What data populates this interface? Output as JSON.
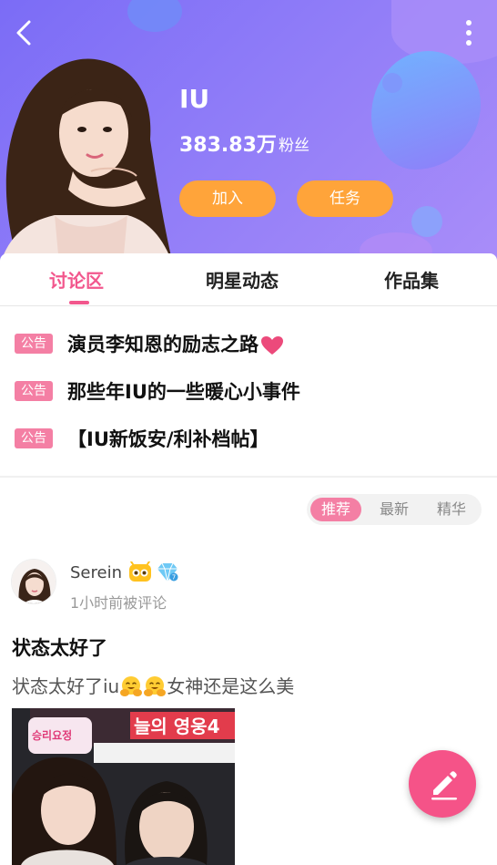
{
  "header": {
    "star_name": "IU",
    "fan_count": "383.83万",
    "fan_label": "粉丝",
    "join_label": "加入",
    "task_label": "任务"
  },
  "tabs": [
    {
      "label": "讨论区",
      "active": true
    },
    {
      "label": "明星动态",
      "active": false
    },
    {
      "label": "作品集",
      "active": false
    }
  ],
  "notices": [
    {
      "tag": "公告",
      "text": "演员李知恩的励志之路",
      "has_heart": true
    },
    {
      "tag": "公告",
      "text": "那些年IU的一些暖心小事件",
      "has_heart": false
    },
    {
      "tag": "公告",
      "text": "【IU新饭安/利补档帖】",
      "has_heart": false
    }
  ],
  "sort": {
    "options": [
      "推荐",
      "最新",
      "精华"
    ],
    "selected": "推荐"
  },
  "post": {
    "username": "Serein",
    "time": "1小时前被评论",
    "title": "状态太好了",
    "body_prefix": "状态太好了iu",
    "body_suffix": "女神还是这么美",
    "emoji": "hugging-face-icon",
    "image_text_top": "승리요정",
    "image_text_banner": "늘의 영웅4"
  },
  "colors": {
    "accent_pink": "#f2578d",
    "tag_pink": "#f47fa4",
    "button_orange": "#ffa43a",
    "header_purple": "#8f7cf8"
  }
}
